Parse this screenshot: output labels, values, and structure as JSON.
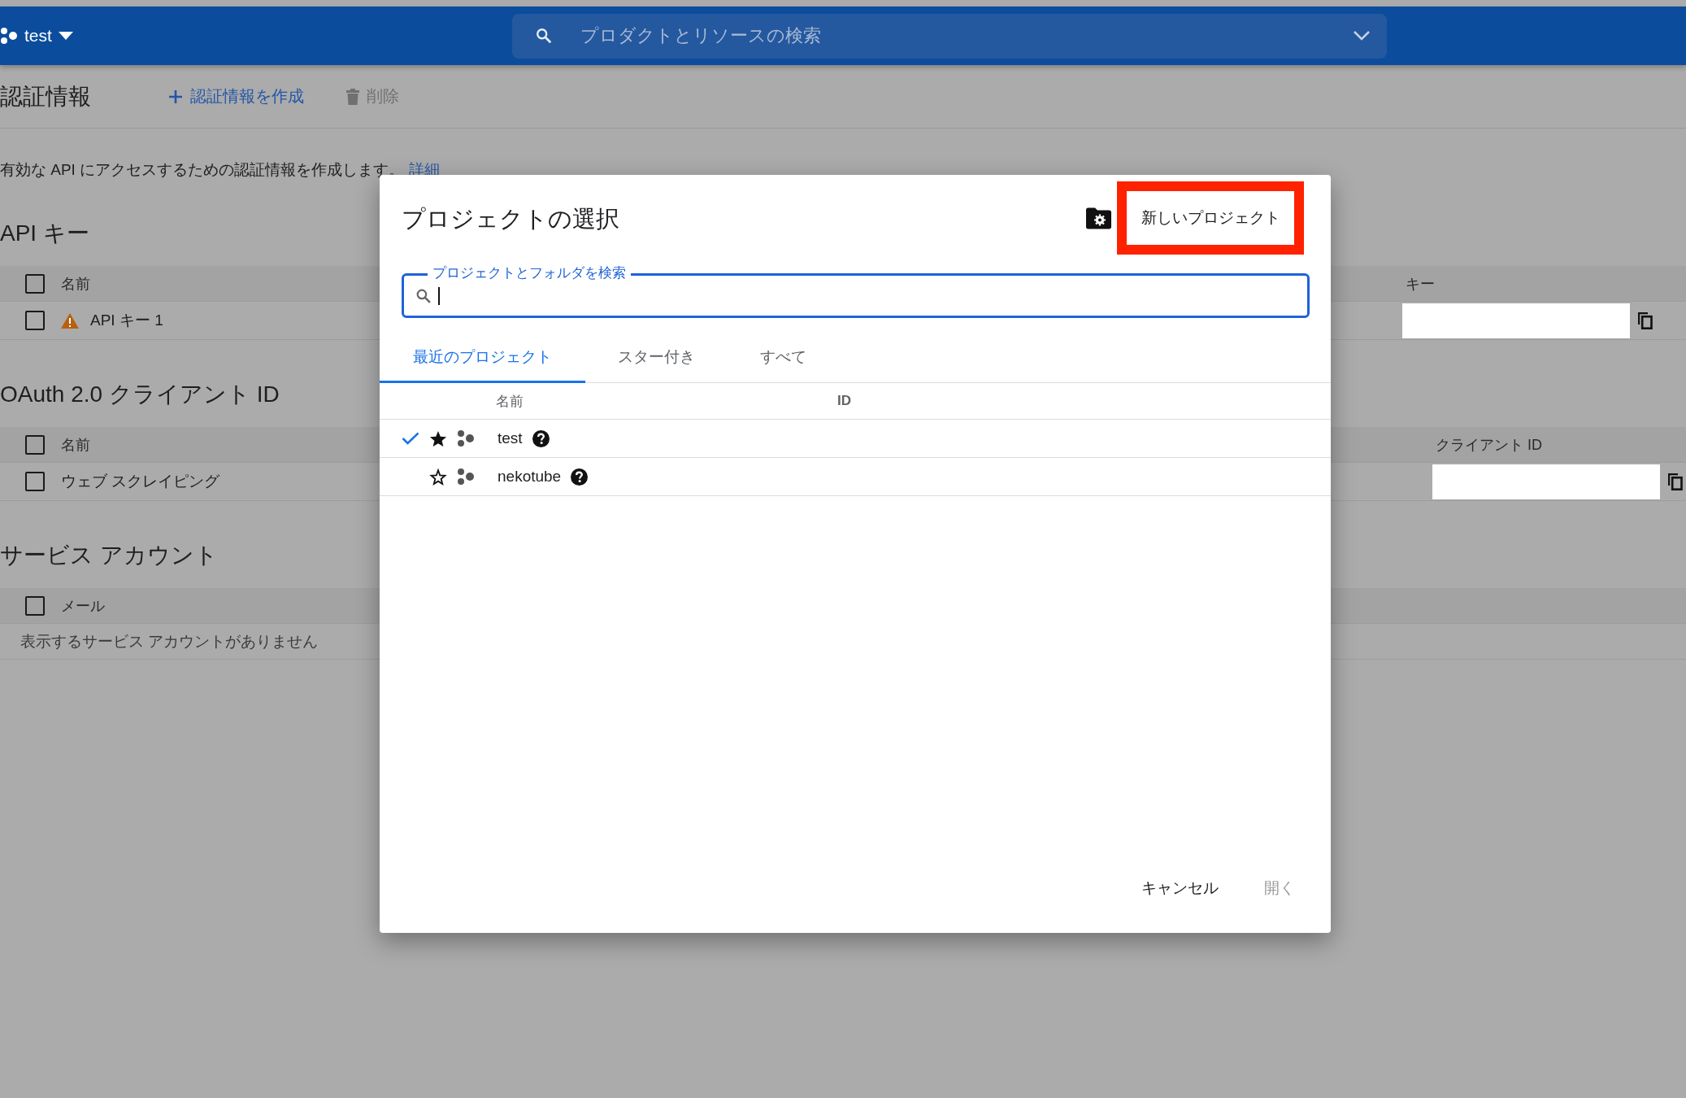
{
  "top_bar": {
    "project": "test",
    "search": {
      "placeholder": "プロダクトとリソースの検索"
    }
  },
  "page": {
    "title": "認証情報",
    "actions": [
      {
        "kind": "create",
        "label": "認証情報を作成",
        "disabled": false
      },
      {
        "kind": "delete",
        "label": "削除",
        "disabled": true
      }
    ],
    "description": "有効な API にアクセスするための認証情報を作成します。",
    "description_link": "詳細",
    "sections": [
      {
        "title": "API キー",
        "columns": [
          "名前",
          "キー"
        ],
        "header_checked": false,
        "rows": [
          {
            "name": "API キー 1",
            "warning": true,
            "checked": false
          }
        ]
      },
      {
        "title": "OAuth 2.0 クライアント ID",
        "columns": [
          "名前",
          "クライアント ID"
        ],
        "header_checked": false,
        "rows": [
          {
            "name": "ウェブ スクレイピング",
            "warning": false,
            "checked": false
          }
        ]
      },
      {
        "title": "サービス アカウント",
        "columns": [
          "メール"
        ],
        "header_checked": false,
        "empty_message": "表示するサービス アカウントがありません"
      }
    ]
  },
  "dialog": {
    "title": "プロジェクトの選択",
    "new_project_button": "新しいプロジェクト",
    "highlighted": true,
    "search": {
      "label": "プロジェクトとフォルダを検索",
      "focused": true
    },
    "tabs": [
      {
        "label": "最近のプロジェクト",
        "selected": true
      },
      {
        "label": "スター付き",
        "selected": false
      },
      {
        "label": "すべて",
        "selected": false
      }
    ],
    "columns": [
      "名前",
      "ID"
    ],
    "projects": [
      {
        "name": "test",
        "current": true,
        "starred": true
      },
      {
        "name": "nekotube",
        "current": false,
        "starred": false
      }
    ],
    "buttons": [
      {
        "label": "キャンセル",
        "disabled": false
      },
      {
        "label": "開く",
        "disabled": true
      }
    ]
  }
}
